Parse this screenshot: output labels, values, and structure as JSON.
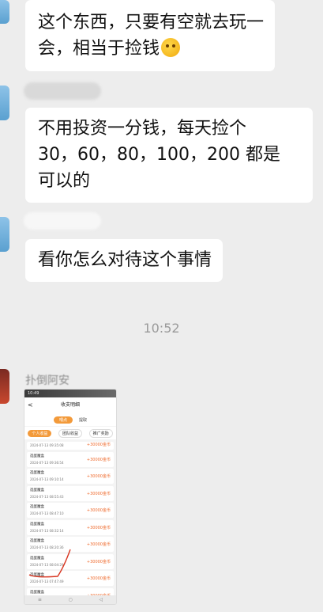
{
  "messages": [
    {
      "lines": [
        "这个东西，只要有空就去玩一",
        "会，相当于捡钱"
      ],
      "emoji": "thinking-face"
    },
    {
      "lines": [
        "不用投资一分钱，每天捡个",
        "30，60，80，100，200 都是",
        "可以的"
      ]
    },
    {
      "lines": [
        "看你怎么对待这个事情"
      ]
    }
  ],
  "timestamp": "10:52",
  "sender_name": "扑倒阿安",
  "screenshot": {
    "status_time": "10:49",
    "title": "收支明细",
    "back_glyph": "<",
    "top_tabs": [
      "喂点",
      "提取"
    ],
    "sub_tabs": [
      "个人收益",
      "团队收益",
      "推广奖励"
    ],
    "first_row": {
      "date": "2024-07-13 09:35:08",
      "amount": "+30000金币"
    },
    "records": [
      {
        "name": "选蛋魔盒",
        "date": "2024-07-13 09:36:54",
        "amount": "+30000金币"
      },
      {
        "name": "选蛋魔盒",
        "date": "2024-07-13 09:10:14",
        "amount": "+30000金币"
      },
      {
        "name": "选蛋魔盒",
        "date": "2024-07-13 08:55:43",
        "amount": "+30000金币"
      },
      {
        "name": "选蛋魔盒",
        "date": "2024-07-13 08:47:10",
        "amount": "+30000金币"
      },
      {
        "name": "选蛋魔盒",
        "date": "2024-07-13 08:32:14",
        "amount": "+30000金币"
      },
      {
        "name": "选蛋魔盒",
        "date": "2024-07-13 08:20:36",
        "amount": "+30000金币"
      },
      {
        "name": "选蛋魔盒",
        "date": "2024-07-13 08:04:29",
        "amount": "+30000金币"
      },
      {
        "name": "选蛋魔盒",
        "date": "2024-07-13 07:47:49",
        "amount": "+30000金币"
      },
      {
        "name": "选蛋魔盒",
        "date": "2024-07-13 07:27:02",
        "amount": "+30000金币"
      }
    ],
    "nav": [
      "≡",
      "○",
      "◁"
    ]
  }
}
